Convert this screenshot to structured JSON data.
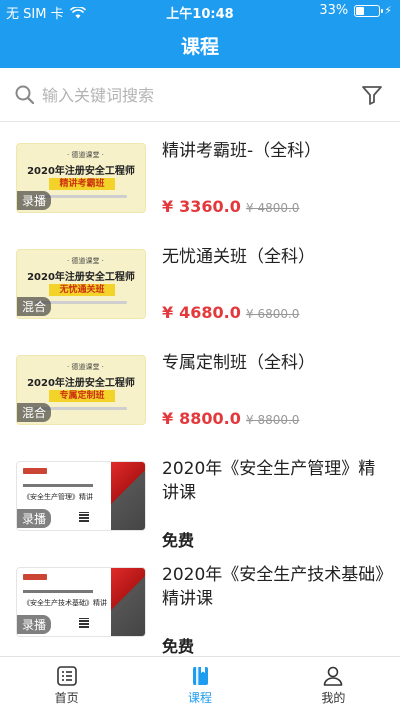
{
  "status_bar": {
    "carrier": "无 SIM 卡",
    "time": "上午10:48",
    "battery_percent_text": "33%",
    "battery_level": 0.33
  },
  "header": {
    "title": "课程"
  },
  "search": {
    "placeholder": "输入关键词搜索"
  },
  "courses": [
    {
      "title": "精讲考霸班-（全科）",
      "price": "3360.0",
      "original_price": "¥ 4800.0",
      "badge": "录播",
      "thumb": {
        "style": "yellow",
        "small": "· 德道课堂 ·",
        "headline": "2020年注册安全工程师",
        "ribbon": "精讲考霸班"
      }
    },
    {
      "title": "无忧通关班（全科）",
      "price": "4680.0",
      "original_price": "¥ 6800.0",
      "badge": "混合",
      "thumb": {
        "style": "yellow",
        "small": "· 德道课堂 ·",
        "headline": "2020年注册安全工程师",
        "ribbon": "无忧通关班"
      }
    },
    {
      "title": "专属定制班（全科）",
      "price": "8800.0",
      "original_price": "¥ 8800.0",
      "badge": "混合",
      "thumb": {
        "style": "yellow",
        "small": "· 德道课堂 ·",
        "headline": "2020年注册安全工程师",
        "ribbon": "专属定制班"
      }
    },
    {
      "title": "2020年《安全生产管理》精讲课",
      "free": "免费",
      "badge": "录播",
      "thumb": {
        "style": "white",
        "sub": "《安全生产管理》精讲"
      }
    },
    {
      "title": "2020年《安全生产技术基础》精讲课",
      "free": "免费",
      "badge": "录播",
      "thumb": {
        "style": "white",
        "sub": "《安全生产技术基础》精讲"
      }
    }
  ],
  "price_prefix": "¥",
  "tabbar": {
    "items": [
      {
        "label": "首页",
        "icon": "home-list-icon"
      },
      {
        "label": "课程",
        "icon": "course-book-icon",
        "active": true
      },
      {
        "label": "我的",
        "icon": "profile-icon"
      }
    ]
  },
  "colors": {
    "primary": "#1e9cf0",
    "price": "#e4393c"
  }
}
